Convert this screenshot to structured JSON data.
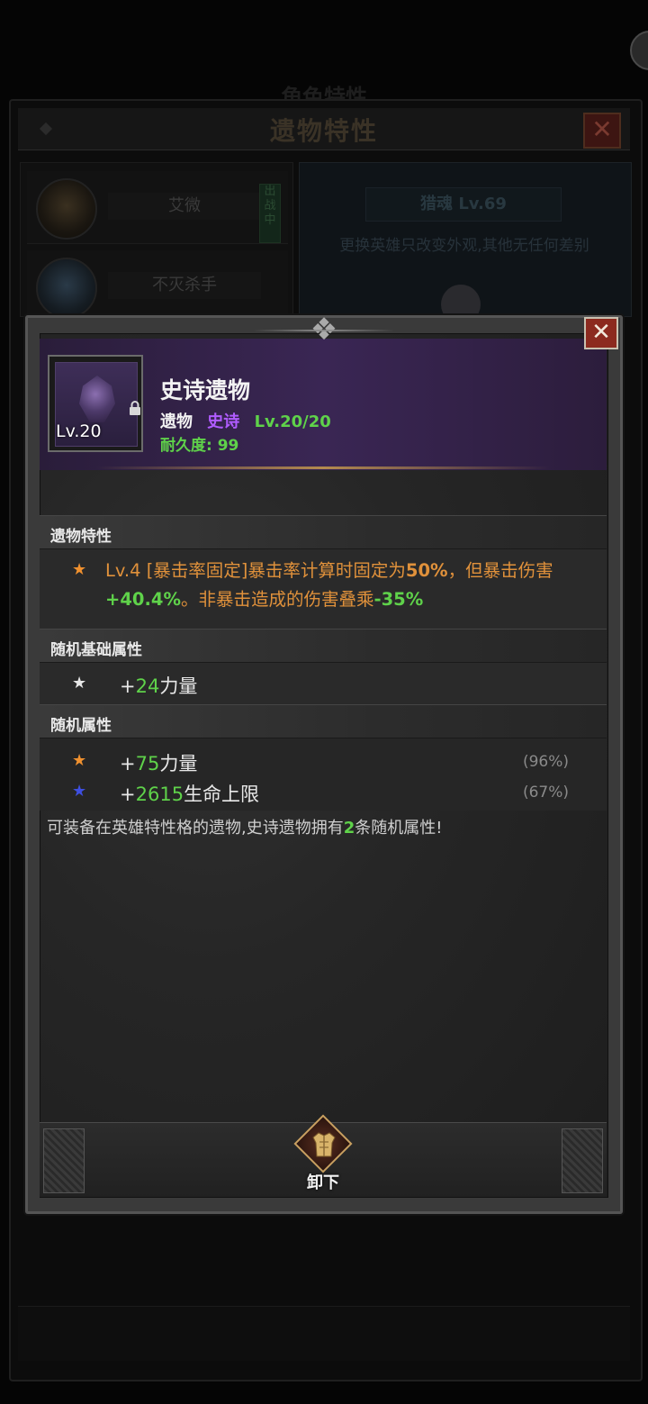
{
  "background": {
    "ghost_title": "角色特性",
    "window_title": "遗物特性",
    "heroes": [
      {
        "name": "艾微",
        "badge": "出战中"
      },
      {
        "name": "不灭杀手",
        "badge": ""
      }
    ],
    "hero_level": "猎魂 Lv.69",
    "note": "更换英雄只改变外观,其他无任何差别"
  },
  "popup": {
    "item": {
      "name": "史诗遗物",
      "icon": "relic-gem-icon",
      "icon_level": "Lv.20",
      "type": "遗物",
      "rarity": "史诗",
      "level": "Lv.20/20",
      "durability": "耐久度: 99"
    },
    "sections": {
      "relic_trait": {
        "title": "遗物特性",
        "line_prefix": "Lv.4 [暴击率固定]暴击率计算时固定为",
        "value1": "50%",
        "mid1": "，但暴击伤害",
        "value2": "+40.4%",
        "mid2": "。非暴击造成的伤害叠乘",
        "value3": "-35%"
      },
      "random_base": {
        "title": "随机基础属性",
        "stats": [
          {
            "plus": "+",
            "value": "24",
            "label": "力量"
          }
        ]
      },
      "random_attr": {
        "title": "随机属性",
        "stats": [
          {
            "plus": "+",
            "value": "75",
            "label": "力量",
            "percent": "(96%)"
          },
          {
            "plus": "+",
            "value": "2615",
            "label": "生命上限",
            "percent": "(67%)"
          }
        ]
      }
    },
    "description": {
      "prefix": "可装备在英雄特性格的遗物,史诗遗物拥有",
      "count": "2",
      "suffix": "条随机属性!"
    },
    "unequip_label": "卸下"
  },
  "colors": {
    "green": "#5fd24a",
    "purple": "#b05cff",
    "orange": "#e0913b",
    "close_red": "#8c2a1f"
  }
}
